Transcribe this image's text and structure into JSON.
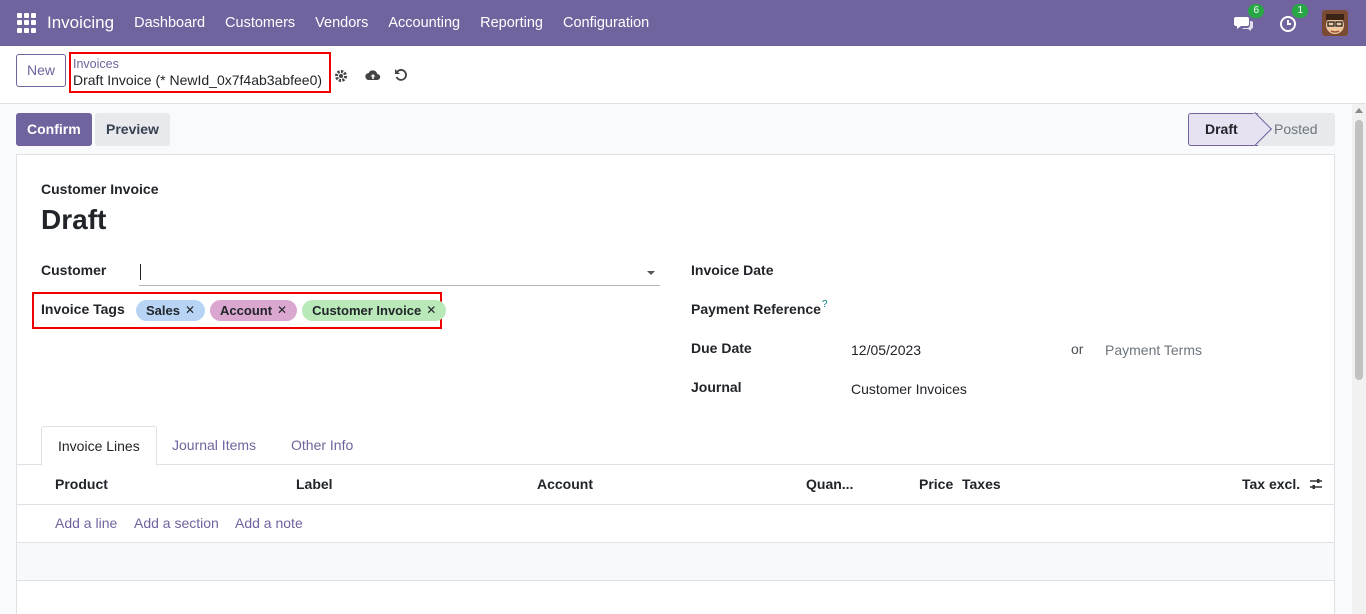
{
  "navbar": {
    "app_name": "Invoicing",
    "menu": [
      "Dashboard",
      "Customers",
      "Vendors",
      "Accounting",
      "Reporting",
      "Configuration"
    ],
    "messages_count": "6",
    "activities_count": "1",
    "bg_color": "#71639e"
  },
  "control": {
    "new_label": "New",
    "breadcrumb_parent": "Invoices",
    "breadcrumb_current": "Draft Invoice (* NewId_0x7f4ab3abfee0)"
  },
  "actions": {
    "confirm_label": "Confirm",
    "preview_label": "Preview"
  },
  "status": {
    "draft": "Draft",
    "posted": "Posted"
  },
  "form": {
    "doc_type": "Customer Invoice",
    "title": "Draft",
    "customer_label": "Customer",
    "customer_value": "",
    "tags_label": "Invoice Tags",
    "tags": [
      {
        "name": "Sales",
        "color": "#b8d4f5"
      },
      {
        "name": "Account",
        "color": "#d9a7cf"
      },
      {
        "name": "Customer Invoice",
        "color": "#b9e8b9"
      }
    ],
    "invoice_date_label": "Invoice Date",
    "payment_ref_label": "Payment Reference",
    "payment_ref_help": "?",
    "due_date_label": "Due Date",
    "due_date_value": "12/05/2023",
    "or_text": "or",
    "payment_terms_placeholder": "Payment Terms",
    "journal_label": "Journal",
    "journal_value": "Customer Invoices"
  },
  "tabs": [
    "Invoice Lines",
    "Journal Items",
    "Other Info"
  ],
  "lines_table": {
    "columns": [
      "Product",
      "Label",
      "Account",
      "Quan...",
      "Price",
      "Taxes",
      "Tax excl."
    ],
    "add_line": "Add a line",
    "add_section": "Add a section",
    "add_note": "Add a note"
  }
}
